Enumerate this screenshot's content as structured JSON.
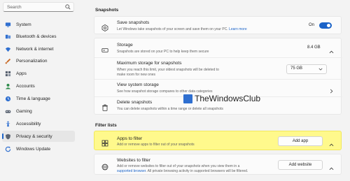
{
  "sidebar": {
    "search_placeholder": "Search",
    "items": [
      {
        "label": "System",
        "icon": "monitor-icon",
        "color": "#2f6fd0"
      },
      {
        "label": "Bluetooth & devices",
        "icon": "bluetooth-icon",
        "color": "#2f6fd0"
      },
      {
        "label": "Network & internet",
        "icon": "wifi-icon",
        "color": "#2f6fd0"
      },
      {
        "label": "Personalization",
        "icon": "brush-icon",
        "color": "#c96b28"
      },
      {
        "label": "Apps",
        "icon": "apps-icon",
        "color": "#5b6472"
      },
      {
        "label": "Accounts",
        "icon": "person-icon",
        "color": "#2f8c4c"
      },
      {
        "label": "Time & language",
        "icon": "globe-clock-icon",
        "color": "#2f6fd0"
      },
      {
        "label": "Gaming",
        "icon": "gamepad-icon",
        "color": "#5b6472"
      },
      {
        "label": "Accessibility",
        "icon": "accessibility-icon",
        "color": "#2f6fd0"
      },
      {
        "label": "Privacy & security",
        "icon": "shield-icon",
        "color": "#5b6472"
      },
      {
        "label": "Windows Update",
        "icon": "sync-icon",
        "color": "#2f6fd0"
      }
    ],
    "active_index": 9
  },
  "snapshots": {
    "section_title": "Snapshots",
    "save": {
      "title": "Save snapshots",
      "desc": "Let Windows take snapshots of your screen and save them on your PC.",
      "link": "Learn more",
      "toggle_label": "On",
      "toggle_state": true
    },
    "storage": {
      "title": "Storage",
      "desc": "Snapshots are stored on your PC to help keep them secure",
      "value": "8.4 GB"
    },
    "max_storage": {
      "title": "Maximum storage for snapshots",
      "desc1": "When you reach this limit, your oldest snapshots will be deleted to",
      "desc2": "make room for new ones",
      "value": "75 GB"
    },
    "view_storage": {
      "title": "View system storage",
      "desc": "See how snapshot storage compares to other data categories"
    },
    "delete": {
      "title": "Delete snapshots",
      "desc": "You can delete snapshots within a time range or delete all snapshots"
    }
  },
  "watermark": "TheWindowsClub",
  "filter_lists": {
    "section_title": "Filter lists",
    "apps": {
      "title": "Apps to filter",
      "desc": "Add or remove apps to filter out of your snapshots",
      "button": "Add app",
      "highlight_color": "#fff98c"
    },
    "websites": {
      "title": "Websites to filter",
      "desc1": "Add or remove websites to filter out of your snapshots when you view them in a",
      "desc2_link": "supported browser",
      "desc2_rest": ". All private browsing activity in supported browsers will be filtered.",
      "button": "Add website"
    }
  }
}
